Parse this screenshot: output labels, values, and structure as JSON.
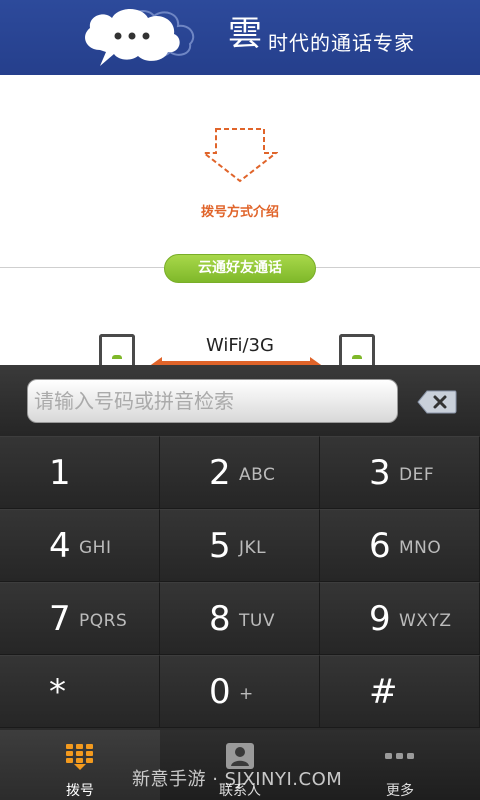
{
  "header": {
    "brand_char": "雲",
    "slogan": "时代的通话专家"
  },
  "intro": {
    "link_label": "拨号方式介绍",
    "friend_button": "云通好友通话",
    "network_label": "WiFi/3G"
  },
  "dialer": {
    "search_placeholder": "请输入号码或拼音检索",
    "keys": [
      {
        "digit": "1",
        "letters": ""
      },
      {
        "digit": "2",
        "letters": "ABC"
      },
      {
        "digit": "3",
        "letters": "DEF"
      },
      {
        "digit": "4",
        "letters": "GHI"
      },
      {
        "digit": "5",
        "letters": "JKL"
      },
      {
        "digit": "6",
        "letters": "MNO"
      },
      {
        "digit": "7",
        "letters": "PQRS"
      },
      {
        "digit": "8",
        "letters": "TUV"
      },
      {
        "digit": "9",
        "letters": "WXYZ"
      },
      {
        "digit": "*",
        "letters": ""
      },
      {
        "digit": "0",
        "letters": "+"
      },
      {
        "digit": "#",
        "letters": ""
      }
    ]
  },
  "nav": {
    "tabs": [
      {
        "label": "拨号",
        "icon": "dialpad-icon",
        "active": true
      },
      {
        "label": "联系人",
        "icon": "contacts-icon",
        "active": false
      },
      {
        "label": "更多",
        "icon": "more-icon",
        "active": false
      }
    ]
  },
  "watermark": "新意手游 · SJXINYI.COM",
  "colors": {
    "header_bg": "#2d4a9b",
    "accent_orange": "#e0642a",
    "friend_green": "#8bc34a",
    "dialer_bg": "#2b2b2b"
  }
}
